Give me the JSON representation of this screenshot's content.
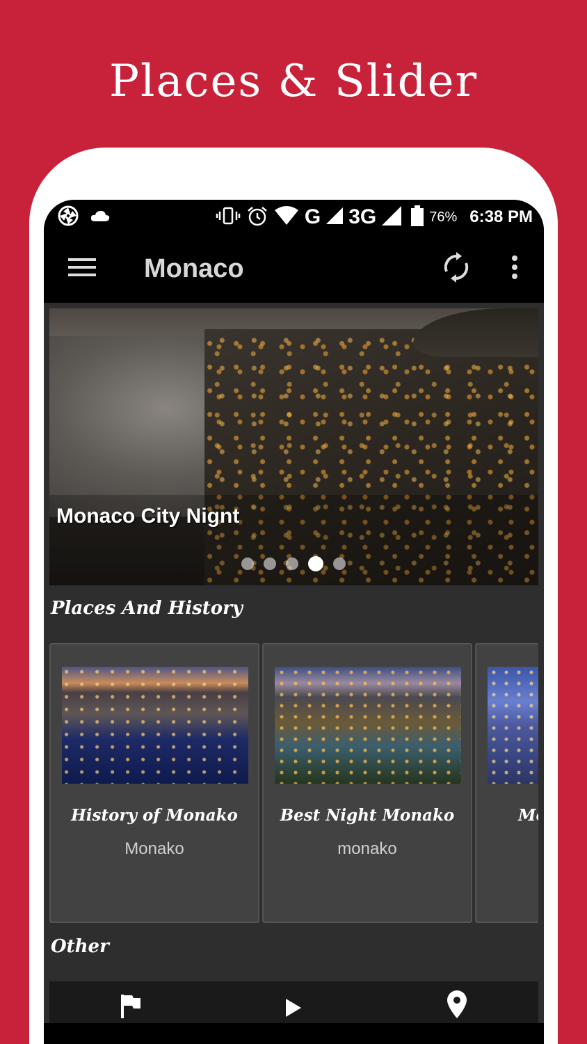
{
  "promo": {
    "title": "Places & Slider"
  },
  "status_bar": {
    "network_g": "G",
    "network_3g": "3G",
    "battery": "76%",
    "time": "6:38 PM"
  },
  "toolbar": {
    "title": "Monaco"
  },
  "slider": {
    "caption": "Monaco City Nignt",
    "slide_count": 5,
    "active_slide": 4
  },
  "sections": {
    "places": "Places And History",
    "other": "Other"
  },
  "cards": [
    {
      "title": "History of Monako",
      "subtitle": "Monako"
    },
    {
      "title": "Best Night Monako",
      "subtitle": "monako"
    },
    {
      "title": "Mo",
      "subtitle": ""
    }
  ],
  "tabs": [
    "flag-icon",
    "play-icon",
    "location-pin-icon"
  ],
  "colors": {
    "brand": "#c8213a",
    "toolbar": "#000000",
    "surface": "#2e2e2e",
    "card": "#424242"
  }
}
